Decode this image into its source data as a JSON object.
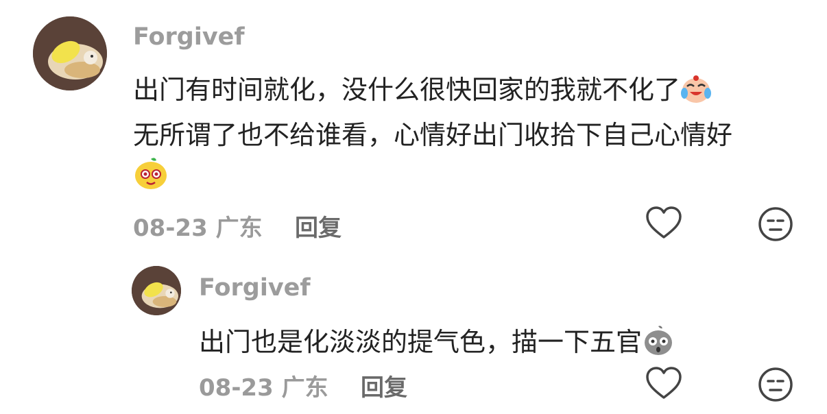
{
  "comment": {
    "username": "Forgivef",
    "lines": [
      "出门有时间就化，没什么很快回家的我就不化了",
      "无所谓了也不给谁看，心情好出门收拾下自己心情好"
    ],
    "date": "08-23",
    "location": "广东",
    "reply_label": "回复",
    "line1_emoji": "laughing-crying-emoji",
    "line3_emoji": "yellow-face-emoji"
  },
  "reply": {
    "username": "Forgivef",
    "text": "出门也是化淡淡的提气色，描一下五官",
    "date": "08-23",
    "location": "广东",
    "reply_label": "回复",
    "emoji": "grey-face-emoji"
  },
  "icons": {
    "like": "heart-outline-icon",
    "dislike": "neutral-face-icon"
  },
  "colors": {
    "username": "#9c9c9c",
    "text": "#222222",
    "meta": "#9a9a9a"
  }
}
